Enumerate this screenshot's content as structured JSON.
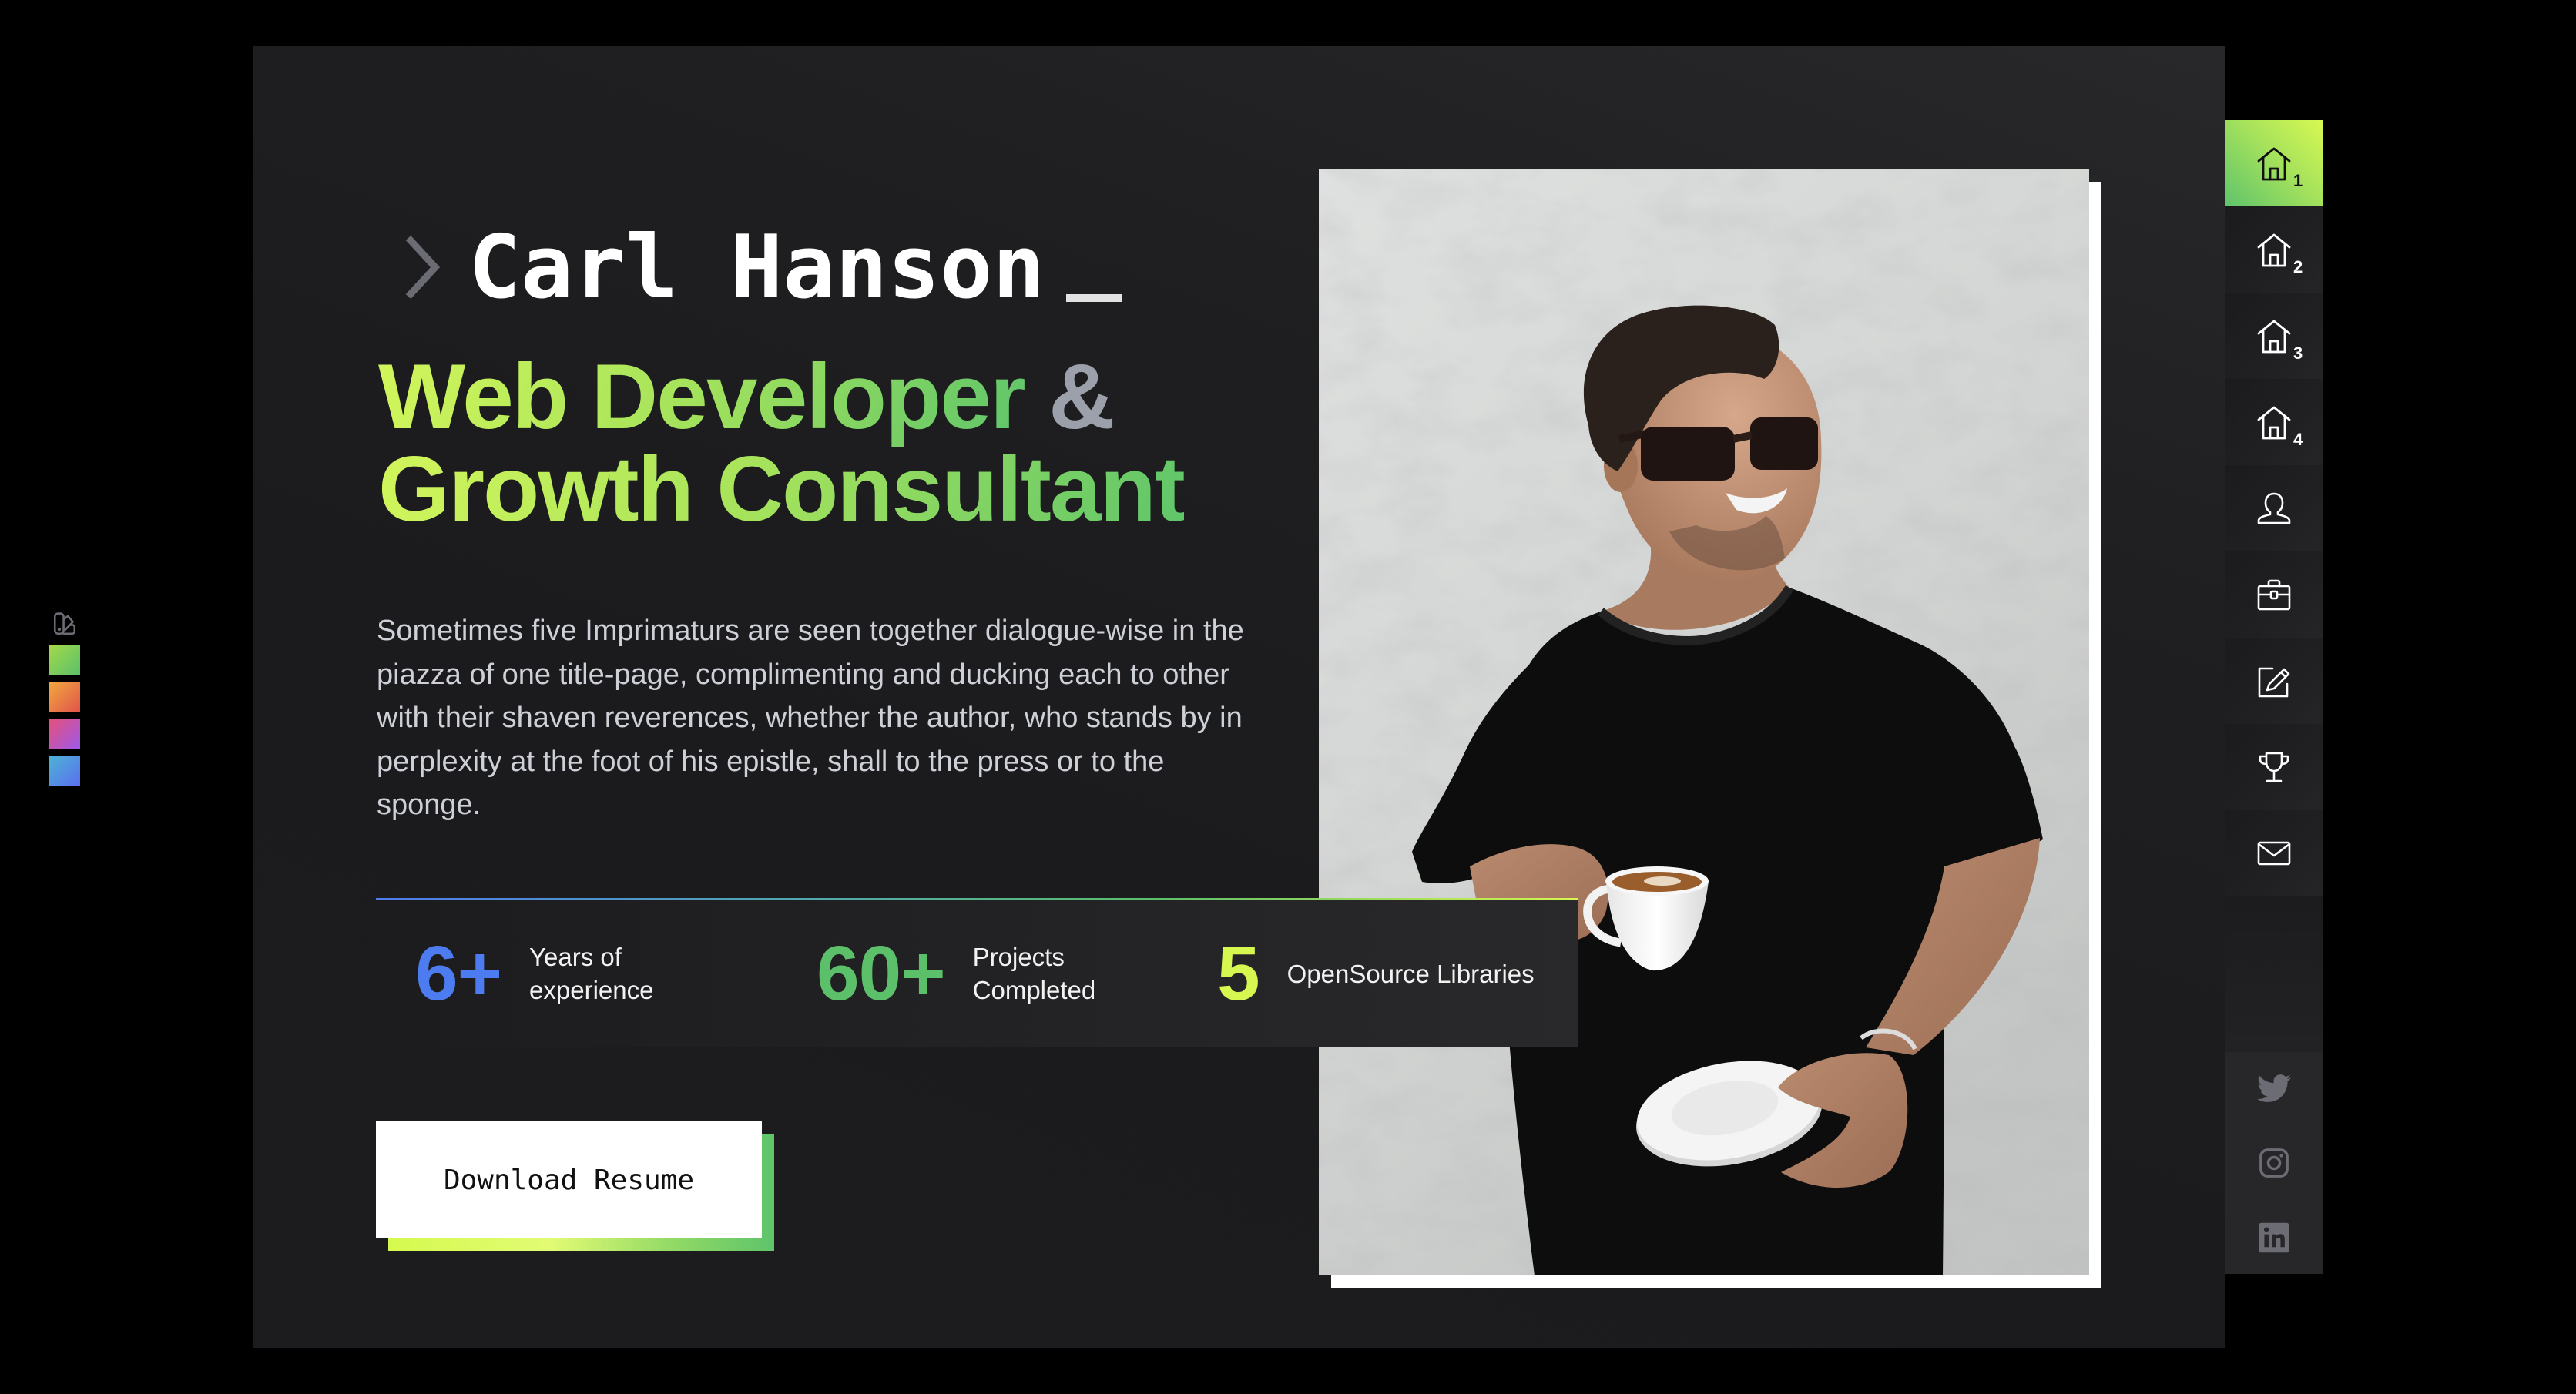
{
  "theme_switcher": {
    "icon": "palette-icon",
    "swatches": [
      {
        "name": "green",
        "from": "#a3da4a",
        "to": "#5bbf6b"
      },
      {
        "name": "orange",
        "from": "#f2a93f",
        "to": "#e1534b"
      },
      {
        "name": "magenta",
        "from": "#e7507a",
        "to": "#9b5aeb"
      },
      {
        "name": "blue",
        "from": "#4cb4d5",
        "to": "#5b6ef0"
      }
    ]
  },
  "hero": {
    "prompt_icon": "chevron-right-icon",
    "name": "Carl Hanson",
    "headline": {
      "line1": "Web Developer",
      "ampersand": "&",
      "line2": "Growth Consultant"
    },
    "bio": "Sometimes five Imprimaturs are seen together dialogue-wise in the piazza of one title-page, complimenting and ducking each to other with their shaven reverences, whether the author, who stands by in perplexity at the foot of his epistle, shall to the press or to the sponge.",
    "stats": [
      {
        "value": "6+",
        "label": "Years of\nexperience",
        "color": "#4d7cf0"
      },
      {
        "value": "60+",
        "label": "Projects\nCompleted",
        "color": "#5cc06a"
      },
      {
        "value": "5",
        "label": "OpenSource Libraries",
        "color": "#d6f74f"
      }
    ],
    "cta": {
      "download_resume": "Download Resume"
    }
  },
  "sidebar": {
    "nav": [
      {
        "icon": "home-icon",
        "subscript": "1",
        "active": true
      },
      {
        "icon": "home-icon",
        "subscript": "2",
        "active": false
      },
      {
        "icon": "home-icon",
        "subscript": "3",
        "active": false
      },
      {
        "icon": "home-icon",
        "subscript": "4",
        "active": false
      },
      {
        "icon": "user-icon",
        "active": false
      },
      {
        "icon": "briefcase-icon",
        "active": false
      },
      {
        "icon": "edit-icon",
        "active": false
      },
      {
        "icon": "trophy-icon",
        "active": false
      },
      {
        "icon": "mail-icon",
        "active": false
      }
    ],
    "social": [
      {
        "icon": "twitter-icon"
      },
      {
        "icon": "instagram-icon"
      },
      {
        "icon": "linkedin-icon"
      }
    ]
  },
  "colors": {
    "accent_from": "#d8f952",
    "accent_to": "#5ec46a",
    "ampersand": "#9ca0ab",
    "panel_bg": "#1c1c1e",
    "social_icon": "#6c6c74"
  }
}
